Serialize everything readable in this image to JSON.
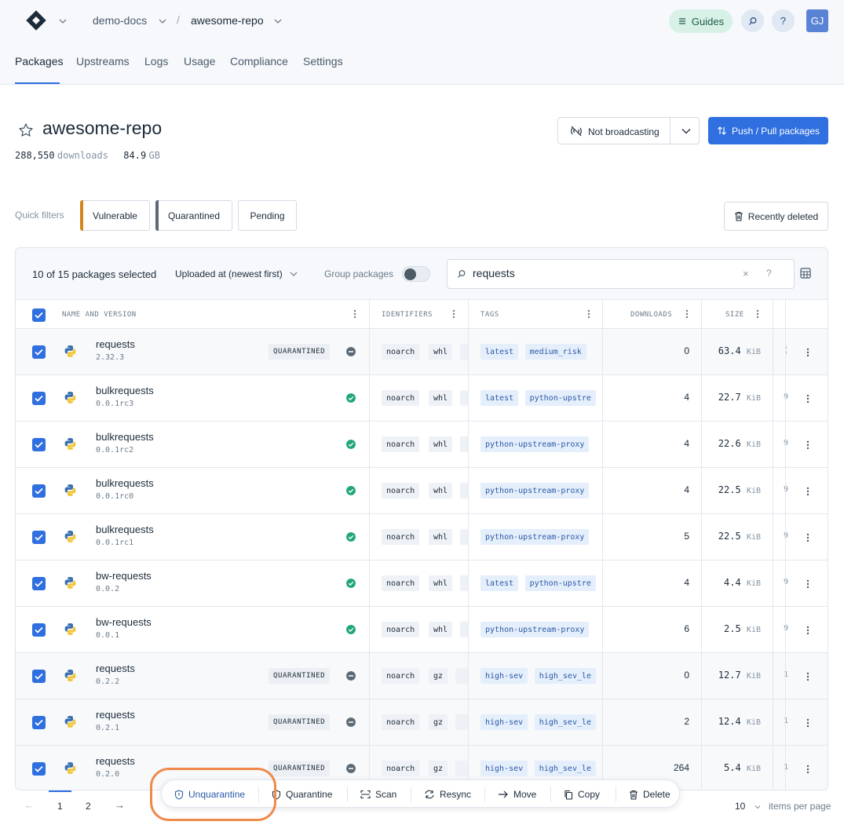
{
  "header": {
    "org": "demo-docs",
    "repo": "awesome-repo",
    "separator": "/",
    "guides_label": "Guides",
    "help_label": "?",
    "avatar_initials": "GJ"
  },
  "tabs": [
    {
      "label": "Packages",
      "active": true
    },
    {
      "label": "Upstreams"
    },
    {
      "label": "Logs"
    },
    {
      "label": "Usage"
    },
    {
      "label": "Compliance"
    },
    {
      "label": "Settings"
    }
  ],
  "repo": {
    "title": "awesome-repo",
    "downloads_value": "288,550",
    "downloads_unit": "downloads",
    "size_value": "84.9",
    "size_unit": "GB",
    "broadcast_label": "Not broadcasting",
    "push_label": "Push / Pull packages"
  },
  "quick_filters": {
    "label": "Quick filters",
    "items": [
      {
        "label": "Vulnerable",
        "color": "#d3861f"
      },
      {
        "label": "Quarantined",
        "color": "#5c6a76"
      },
      {
        "label": "Pending"
      }
    ],
    "recently_deleted": "Recently deleted"
  },
  "toolbar": {
    "selection": "10 of 15 packages selected",
    "sort": "Uploaded at (newest first)",
    "group_label": "Group packages",
    "search_value": "requests",
    "clear_label": "×",
    "help_label": "?"
  },
  "columns": [
    "NAME AND VERSION",
    "IDENTIFIERS",
    "TAGS",
    "DOWNLOADS",
    "SIZE"
  ],
  "rows": [
    {
      "name": "requests",
      "version": "2.32.3",
      "status": "quarantined",
      "badge": "QUARANTINED",
      "ids": [
        "noarch",
        "whl"
      ],
      "tags": [
        "latest",
        "medium_risk"
      ],
      "downloads": "0",
      "size": "63.4",
      "unit": "KiB",
      "trunc": "("
    },
    {
      "name": "bulkrequests",
      "version": "0.0.1rc3",
      "status": "ok",
      "ids": [
        "noarch",
        "whl"
      ],
      "tags": [
        "latest",
        "python-upstre"
      ],
      "downloads": "4",
      "size": "22.7",
      "unit": "KiB",
      "trunc": "9"
    },
    {
      "name": "bulkrequests",
      "version": "0.0.1rc2",
      "status": "ok",
      "ids": [
        "noarch",
        "whl"
      ],
      "tags": [
        "python-upstream-proxy"
      ],
      "downloads": "4",
      "size": "22.6",
      "unit": "KiB",
      "trunc": "9"
    },
    {
      "name": "bulkrequests",
      "version": "0.0.1rc0",
      "status": "ok",
      "ids": [
        "noarch",
        "whl"
      ],
      "tags": [
        "python-upstream-proxy"
      ],
      "downloads": "4",
      "size": "22.5",
      "unit": "KiB",
      "trunc": "9"
    },
    {
      "name": "bulkrequests",
      "version": "0.0.1rc1",
      "status": "ok",
      "ids": [
        "noarch",
        "whl"
      ],
      "tags": [
        "python-upstream-proxy"
      ],
      "downloads": "5",
      "size": "22.5",
      "unit": "KiB",
      "trunc": "9"
    },
    {
      "name": "bw-requests",
      "version": "0.0.2",
      "status": "ok",
      "ids": [
        "noarch",
        "whl"
      ],
      "tags": [
        "latest",
        "python-upstre"
      ],
      "downloads": "4",
      "size": "4.4",
      "unit": "KiB",
      "trunc": "9"
    },
    {
      "name": "bw-requests",
      "version": "0.0.1",
      "status": "ok",
      "ids": [
        "noarch",
        "whl"
      ],
      "tags": [
        "python-upstream-proxy"
      ],
      "downloads": "6",
      "size": "2.5",
      "unit": "KiB",
      "trunc": "9"
    },
    {
      "name": "requests",
      "version": "0.2.2",
      "status": "quarantined",
      "badge": "QUARANTINED",
      "ids": [
        "noarch",
        "gz"
      ],
      "tags": [
        "high-sev",
        "high_sev_le"
      ],
      "downloads": "0",
      "size": "12.7",
      "unit": "KiB",
      "trunc": "1"
    },
    {
      "name": "requests",
      "version": "0.2.1",
      "status": "quarantined",
      "badge": "QUARANTINED",
      "ids": [
        "noarch",
        "gz"
      ],
      "tags": [
        "high-sev",
        "high_sev_le"
      ],
      "downloads": "2",
      "size": "12.4",
      "unit": "KiB",
      "trunc": "1"
    },
    {
      "name": "requests",
      "version": "0.2.0",
      "status": "quarantined",
      "badge": "QUARANTINED",
      "ids": [
        "noarch",
        "gz"
      ],
      "tags": [
        "high-sev",
        "high_sev_le"
      ],
      "downloads": "264",
      "size": "5.4",
      "unit": "KiB",
      "trunc": "1"
    }
  ],
  "pagination": {
    "pages": [
      "1",
      "2"
    ],
    "current": "1",
    "prev": "←",
    "next": "→",
    "per_page_value": "10",
    "per_page_label": "items per page"
  },
  "actions": [
    {
      "label": "Unquarantine",
      "icon": "unlock-shield-icon",
      "highlighted": true
    },
    {
      "label": "Quarantine",
      "icon": "shield-icon"
    },
    {
      "label": "Scan",
      "icon": "scan-icon"
    },
    {
      "label": "Resync",
      "icon": "resync-icon"
    },
    {
      "label": "Move",
      "icon": "arrow-right-icon"
    },
    {
      "label": "Copy",
      "icon": "copy-icon"
    },
    {
      "label": "Delete",
      "icon": "trash-icon"
    }
  ],
  "colors": {
    "accent": "#2f6fe0",
    "ok": "#20a67a",
    "quarantined": "#5c6a76",
    "highlight_ring": "#f08a4b"
  }
}
